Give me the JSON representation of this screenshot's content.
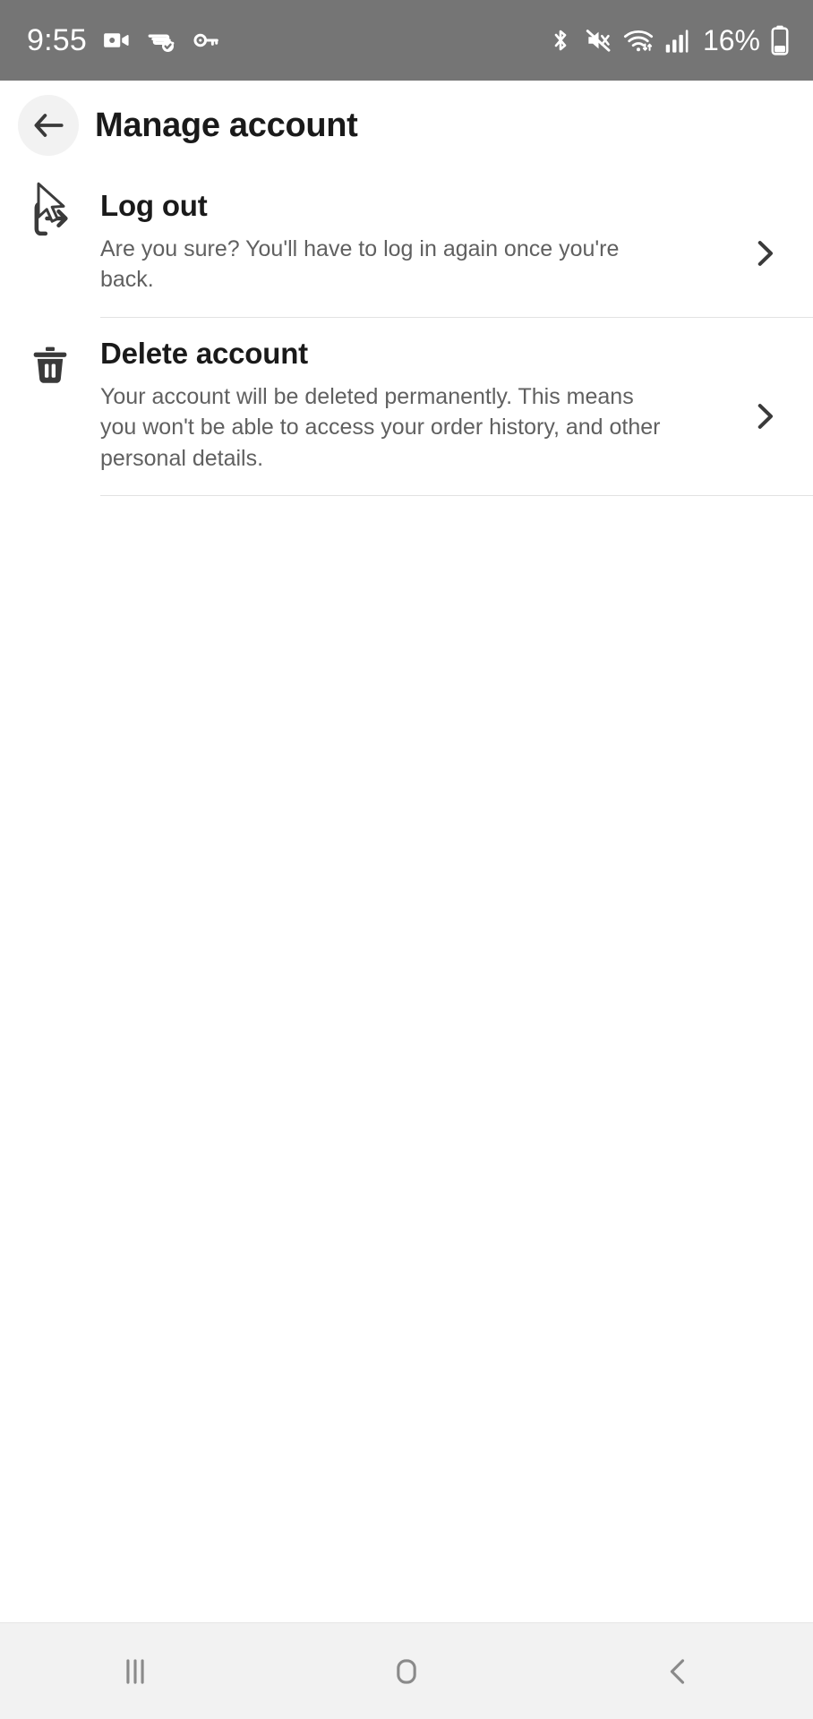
{
  "status_bar": {
    "time": "9:55",
    "battery_text": "16%",
    "left_icons": [
      "video-camera-icon",
      "vpn-icon",
      "key-icon"
    ],
    "right_icons": [
      "bluetooth-icon",
      "mute-icon",
      "wifi-icon",
      "signal-bars-icon",
      "battery-icon"
    ],
    "background_color": "#757575",
    "foreground_color": "#ffffff"
  },
  "header": {
    "title": "Manage account",
    "back_icon": "back-arrow-icon"
  },
  "main": {
    "rows": [
      {
        "icon": "logout-icon",
        "title": "Log out",
        "description": "Are you sure? You'll have to log in again once you're back.",
        "chevron": "chevron-right-icon"
      },
      {
        "icon": "trash-icon",
        "title": "Delete account",
        "description": "Your account will be deleted permanently. This means you won't be able to access your order history, and other personal details.",
        "chevron": "chevron-right-icon"
      }
    ]
  },
  "nav_bar": {
    "buttons": [
      {
        "name": "recents",
        "icon": "recents-icon"
      },
      {
        "name": "home",
        "icon": "home-icon"
      },
      {
        "name": "back",
        "icon": "back-chevron-icon"
      }
    ],
    "background_color": "#f2f2f2"
  },
  "cursor": {
    "icon": "mouse-cursor-icon"
  },
  "colors": {
    "title_text": "#1a1a1a",
    "body_text": "#606060",
    "divider": "#e2e2e2",
    "back_button_bg": "#f2f2f2"
  }
}
